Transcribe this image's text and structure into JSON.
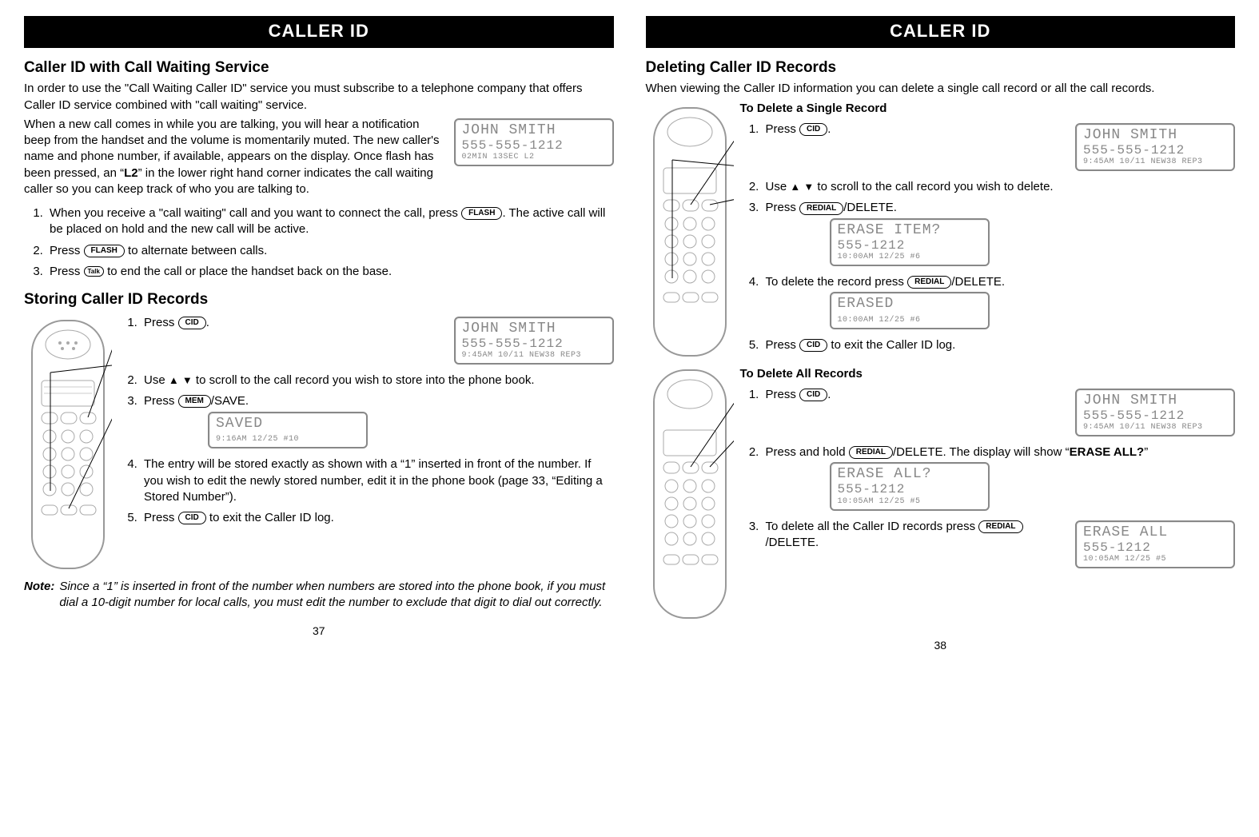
{
  "left": {
    "header": "CALLER ID",
    "h1": "Caller ID with Call Waiting Service",
    "p1": "In order to use the \"Call Waiting Caller ID\" service you must subscribe to a telephone company that offers Caller ID service combined with \"call waiting\" service.",
    "p2a": "When a new call comes in while you are talking, you will hear a notification beep from the handset and the volume is momentarily muted. The new caller's name and phone number, if available, appears on the display.  Once flash has been pressed, an “",
    "p2b_bold": "L2",
    "p2c": "” in the lower right hand corner indicates the call waiting caller so you can keep track of who you are talking to.",
    "lcd_l2": {
      "l1": "JOHN SMITH",
      "l2": "555-555-1212",
      "l3": "02MIN  13SEC   L2"
    },
    "ol1": {
      "s1a": "When you receive a \"call waiting\" call and you want to connect the call, press ",
      "s1b": ".  The active call will be placed on hold and the new call will be active.",
      "s2a": "Press ",
      "s2b": " to alternate between calls.",
      "s3a": "Press ",
      "s3b": " to end the call or place the handset back on the base."
    },
    "h2": "Storing Caller ID Records",
    "store": {
      "s1a": "Press ",
      "s1b": ".",
      "lcd1": {
        "l1": "JOHN SMITH",
        "l2": "555-555-1212",
        "l3": "9:45AM 10/11 NEW38  REP3"
      },
      "s2a": "Use ",
      "s2b": " to scroll to the call record you wish  to store into the phone book.",
      "s3a": "Press ",
      "s3b": "/SAVE.",
      "lcd2": {
        "l1": "SAVED",
        "l2": "",
        "l3": "9:16AM  12/25   #10"
      },
      "s4": "The entry will be stored exactly as shown with a “1” inserted in front of the number.  If you wish to edit the newly stored number, edit it in the phone book (page 33, “Editing a Stored Number”).",
      "s5a": "Press ",
      "s5b": " to exit the Caller ID log."
    },
    "note_label": "Note:",
    "note": "Since a “1” is inserted in front of the number when numbers are stored into the phone book, if you must dial a 10-digit number for local calls, you must edit the number to exclude that digit to dial out correctly.",
    "pagenum": "37"
  },
  "right": {
    "header": "CALLER ID",
    "h1": "Deleting Caller ID Records",
    "p1": "When viewing the Caller ID information you can delete a single call record or all the call records.",
    "single": {
      "head": "To Delete a Single Record",
      "s1a": "Press ",
      "s1b": ".",
      "lcd1": {
        "l1": "JOHN SMITH",
        "l2": "555-555-1212",
        "l3": "9:45AM 10/11 NEW38  REP3"
      },
      "s2a": "Use ",
      "s2b": " to scroll to the call record you wish to delete.",
      "s3a": "Press ",
      "s3b": "/DELETE.",
      "lcd2": {
        "l1": "ERASE ITEM?",
        "l2": "    555-1212",
        "l3": "10:00AM 12/25   #6"
      },
      "s4a": "To delete the record press ",
      "s4b": "/DELETE.",
      "lcd3": {
        "l1": "ERASED",
        "l2": "",
        "l3": "10:00AM 12/25   #6"
      },
      "s5a": "Press ",
      "s5b": " to exit the Caller ID log."
    },
    "all": {
      "head": "To Delete All Records",
      "s1a": "Press ",
      "s1b": ".",
      "lcd1": {
        "l1": "JOHN SMITH",
        "l2": "555-555-1212",
        "l3": "9:45AM 10/11 NEW38  REP3"
      },
      "s2a": "Press and hold ",
      "s2b": "/DELETE.  The display will show “",
      "s2bold": "ERASE ALL?",
      "s2c": "”",
      "lcd2": {
        "l1": "ERASE ALL?",
        "l2": "    555-1212",
        "l3": "10:05AM 12/25   #5"
      },
      "s3a": "To delete all the Caller ID records press ",
      "s3b": "/DELETE.",
      "lcd3": {
        "l1": "ERASE ALL",
        "l2": "    555-1212",
        "l3": "10:05AM 12/25   #5"
      }
    },
    "pagenum": "38"
  },
  "keys": {
    "flash": "FLASH",
    "talk": "Talk",
    "cid": "CID",
    "mem": "MEM",
    "redial": "REDIAL"
  },
  "arrows": {
    "up": "▲",
    "down": "▼"
  }
}
